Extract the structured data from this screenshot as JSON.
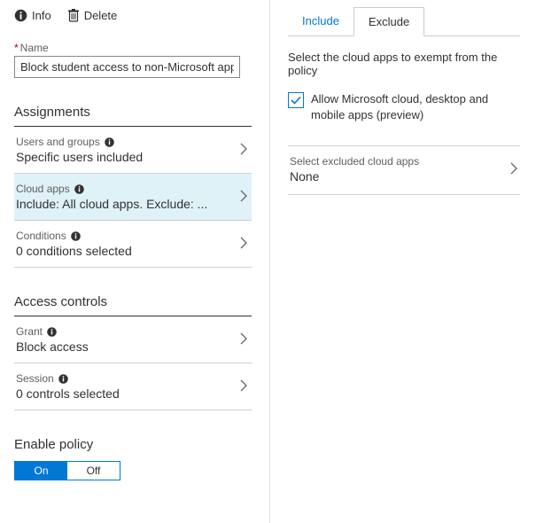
{
  "toolbar": {
    "info": "Info",
    "delete": "Delete"
  },
  "name": {
    "label": "Name",
    "value": "Block student access to non-Microsoft apps"
  },
  "sections": {
    "assignments": "Assignments",
    "accessControls": "Access controls",
    "enablePolicy": "Enable policy"
  },
  "rows": {
    "users": {
      "title": "Users and groups",
      "value": "Specific users included"
    },
    "apps": {
      "title": "Cloud apps",
      "value": "Include: All cloud apps. Exclude: ..."
    },
    "conditions": {
      "title": "Conditions",
      "value": "0 conditions selected"
    },
    "grant": {
      "title": "Grant",
      "value": "Block access"
    },
    "session": {
      "title": "Session",
      "value": "0 controls selected"
    }
  },
  "toggle": {
    "on": "On",
    "off": "Off"
  },
  "tabs": {
    "include": "Include",
    "exclude": "Exclude"
  },
  "excludePane": {
    "desc": "Select the cloud apps to exempt from the policy",
    "allowMs": "Allow Microsoft cloud, desktop and mobile apps (preview)",
    "selectTitle": "Select excluded cloud apps",
    "selectValue": "None"
  }
}
